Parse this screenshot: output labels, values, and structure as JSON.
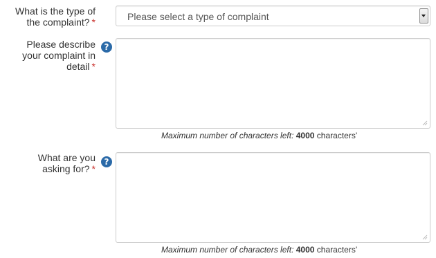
{
  "form": {
    "complaint_type": {
      "label_line1": "What is the type of",
      "label_line2": "the complaint?",
      "required_mark": "*",
      "selected_value": "Please select a type of complaint"
    },
    "description": {
      "label_line1": "Please describe",
      "label_line2": "your complaint in",
      "label_line3": "detail",
      "required_mark": "*",
      "help_icon": "question-circle-icon",
      "value": "",
      "counter": {
        "prefix": "Maximum number of characters left:",
        "count": "4000",
        "suffix": "characters'"
      }
    },
    "request": {
      "label_line1": "What are you",
      "label_line2": "asking for?",
      "required_mark": "*",
      "help_icon": "question-circle-icon",
      "value": "",
      "counter": {
        "prefix": "Maximum number of characters left:",
        "count": "4000",
        "suffix": "characters'"
      }
    }
  },
  "colors": {
    "required": "#c9302c",
    "help_icon_bg": "#2b6aa8",
    "input_border": "#cccccc"
  }
}
